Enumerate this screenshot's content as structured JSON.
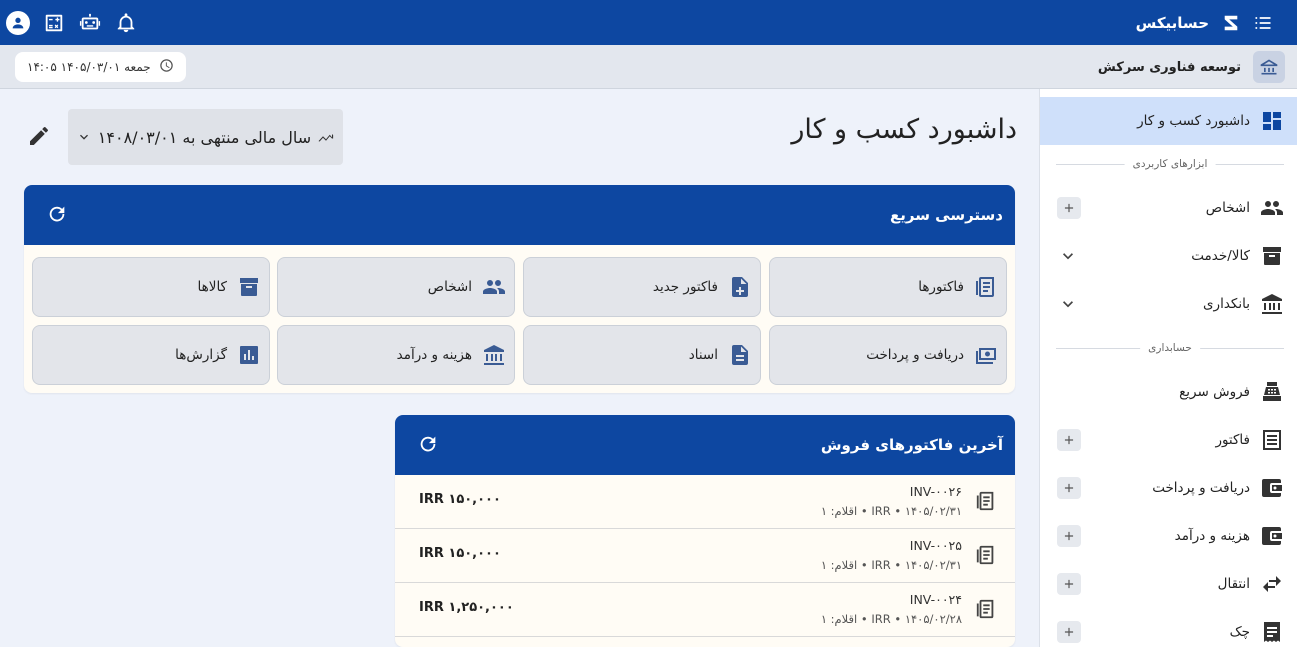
{
  "app": {
    "name": "حسابیکس"
  },
  "company": {
    "name": "توسعه فناوری سرکش"
  },
  "datetime": "جمعه ۱۴۰۵/۰۳/۰۱ ۱۴:۰۵",
  "sidebar": {
    "items": [
      {
        "label": "داشبورد کسب و کار",
        "icon": "dashboard-icon",
        "active": true
      },
      {
        "divider": "ابزارهای کاربردی"
      },
      {
        "label": "اشخاص",
        "icon": "people-icon",
        "control": "plus"
      },
      {
        "label": "کالا/خدمت",
        "icon": "archive-box-icon",
        "control": "chevron"
      },
      {
        "label": "بانکداری",
        "icon": "bank-icon",
        "control": "chevron"
      },
      {
        "divider": "حسابداری"
      },
      {
        "label": "فروش سریع",
        "icon": "cash-register-icon"
      },
      {
        "label": "فاکتور",
        "icon": "receipt-list-icon",
        "control": "plus"
      },
      {
        "label": "دریافت و پرداخت",
        "icon": "wallet-icon",
        "control": "plus"
      },
      {
        "label": "هزینه و درآمد",
        "icon": "wallet-icon",
        "control": "plus"
      },
      {
        "label": "انتقال",
        "icon": "transfer-arrows-icon",
        "control": "plus"
      },
      {
        "label": "چک",
        "icon": "check-receipt-icon",
        "control": "plus"
      }
    ]
  },
  "main": {
    "title": "داشبورد کسب و کار",
    "fiscal_year": "سال مالی منتهی به ۱۴۰۸/۰۳/۰۱"
  },
  "quick_access": {
    "title": "دسترسی سریع",
    "buttons": [
      {
        "label": "فاکتورها",
        "icon": "invoices-icon"
      },
      {
        "label": "فاکتور جدید",
        "icon": "new-file-icon"
      },
      {
        "label": "اشخاص",
        "icon": "people-icon"
      },
      {
        "label": "کالاها",
        "icon": "archive-box-icon"
      },
      {
        "label": "دریافت و پرداخت",
        "icon": "payment-icon"
      },
      {
        "label": "اسناد",
        "icon": "document-icon"
      },
      {
        "label": "هزینه و درآمد",
        "icon": "bank-icon"
      },
      {
        "label": "گزارش‌ها",
        "icon": "bar-chart-icon"
      }
    ]
  },
  "invoices": {
    "title": "آخرین فاکتورهای فروش",
    "rows": [
      {
        "number": "INV-۰۰۲۶",
        "meta": "۱۴۰۵/۰۲/۳۱ • IRR • اقلام: ۱",
        "amount": "IRR ۱۵۰,۰۰۰"
      },
      {
        "number": "INV-۰۰۲۵",
        "meta": "۱۴۰۵/۰۲/۳۱ • IRR • اقلام: ۱",
        "amount": "IRR ۱۵۰,۰۰۰"
      },
      {
        "number": "INV-۰۰۲۴",
        "meta": "۱۴۰۵/۰۲/۲۸ • IRR • اقلام: ۱",
        "amount": "IRR ۱,۲۵۰,۰۰۰"
      }
    ]
  },
  "colors": {
    "primary": "#0d47a1",
    "active_bg": "#cfe0fa",
    "card_bg": "#fffcf5",
    "page_bg": "#eef2fa"
  }
}
